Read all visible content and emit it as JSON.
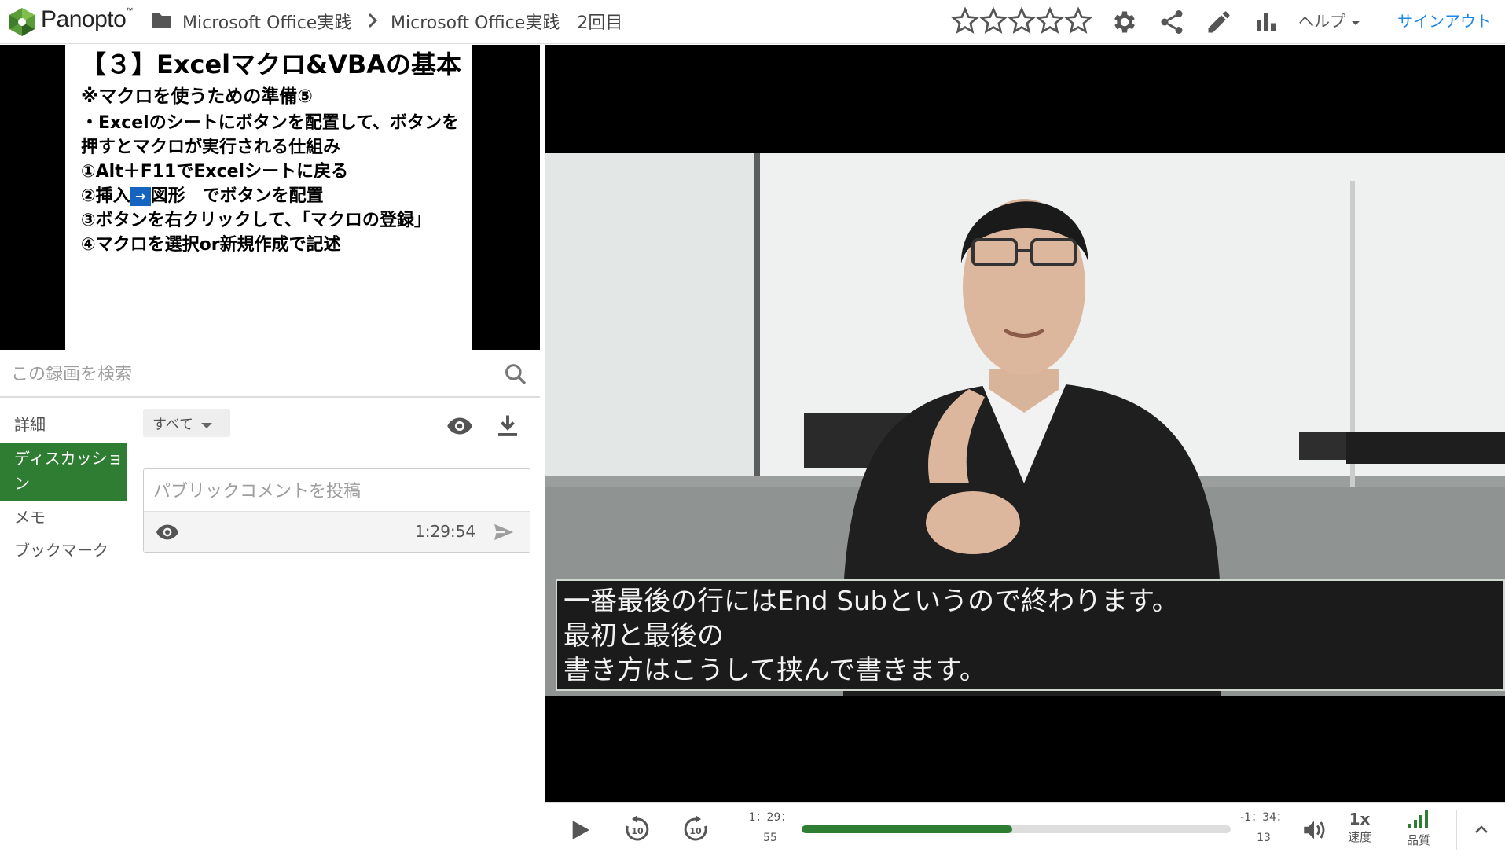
{
  "header": {
    "brand": "Panopto",
    "brand_mark": "™",
    "breadcrumb": [
      "Microsoft Office実践",
      "Microsoft Office実践　2回目"
    ],
    "help_label": "ヘルプ",
    "signout_label": "サインアウト",
    "rating": 0,
    "rating_max": 5
  },
  "slide": {
    "title": "【３】Excelマクロ&VBAの基本",
    "subtitle": "※マクロを使うための準備⑤",
    "lines": [
      "・Excelのシートにボタンを配置して、ボタンを",
      "押すとマクロが実行される仕組み",
      "①Alt＋F11でExcelシートに戻る",
      "③ボタンを右クリックして、「マクロの登録」",
      "④マクロを選択or新規作成で記述"
    ],
    "step2_prefix": "②挿入",
    "step2_arrow": "→",
    "step2_suffix": "図形　でボタンを配置"
  },
  "search": {
    "placeholder": "この録画を検索"
  },
  "side_tabs": [
    "詳細",
    "ディスカッション",
    "メモ",
    "ブックマーク"
  ],
  "discussion": {
    "filter_label": "すべて",
    "comment_placeholder": "パブリックコメントを投稿",
    "timestamp": "1:29:54"
  },
  "video": {
    "caption_lines": [
      "一番最後の行にはEnd Subというので終わります。",
      "最初と最後の",
      "書き方はこうして挟んで書きます。"
    ]
  },
  "controls": {
    "rewind_label": "10",
    "forward_label": "10",
    "elapsed_top": "1：29：",
    "elapsed_bottom": "55",
    "remaining_top": "-1：34：",
    "remaining_bottom": "13",
    "progress_percent": 49,
    "speed_value": "1x",
    "speed_label": "速度",
    "quality_label": "品質"
  },
  "colors": {
    "accent": "#2e7d32",
    "link": "#1e88e5",
    "slide_arrow": "#1565c0"
  }
}
